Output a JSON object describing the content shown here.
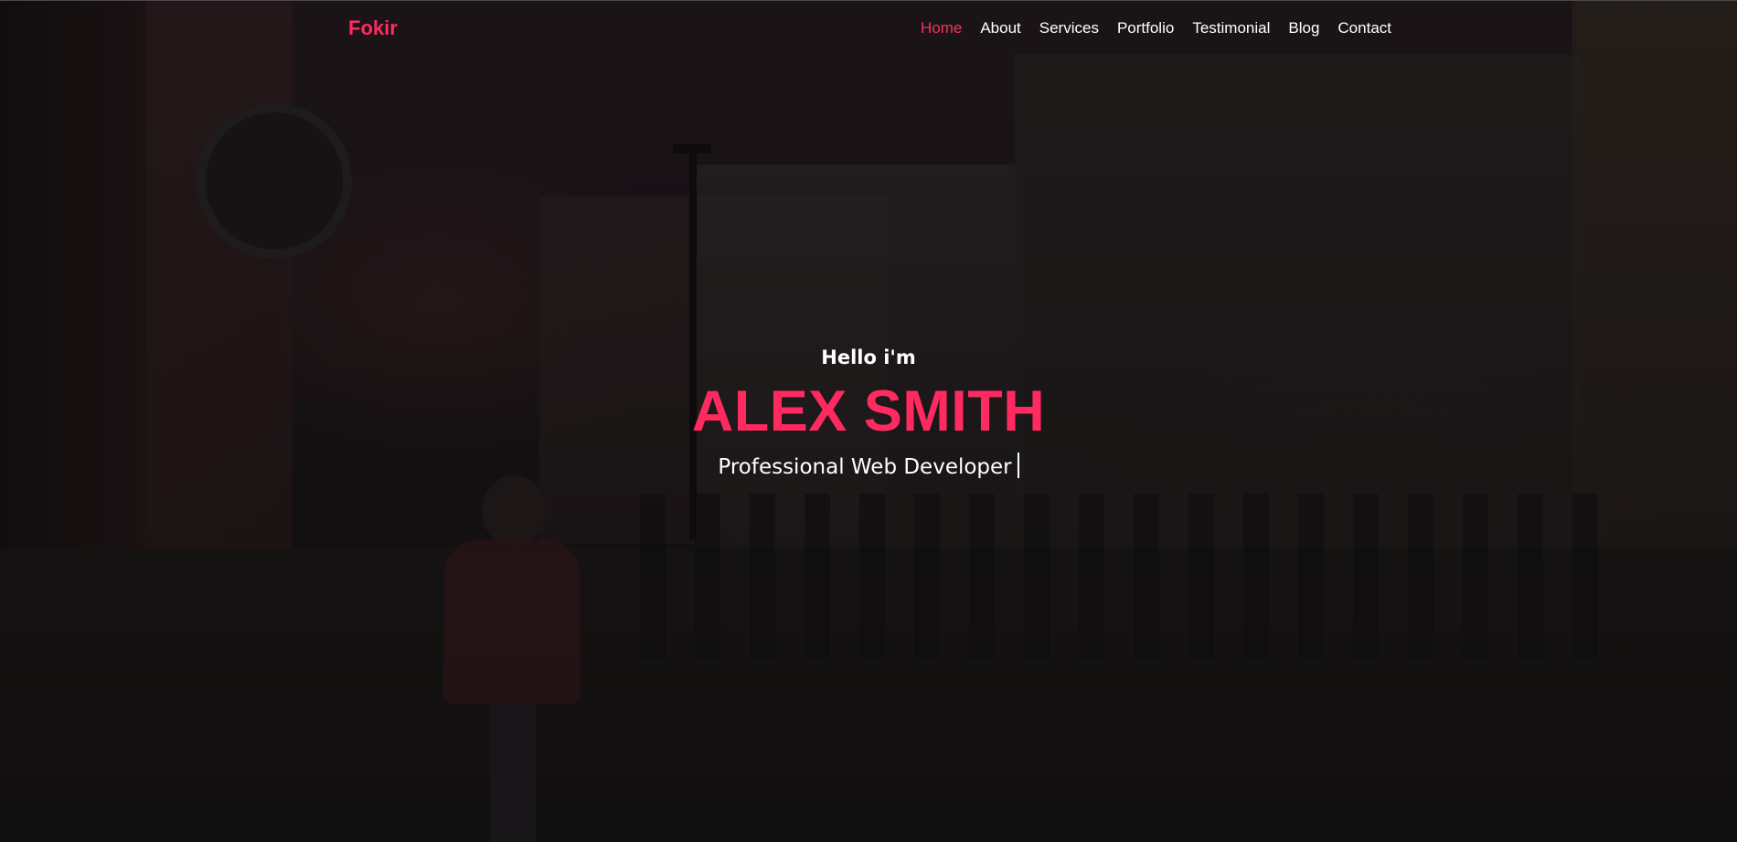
{
  "brand": {
    "name": "Fokir",
    "accent_color": "#ff2a5f"
  },
  "nav": {
    "items": [
      {
        "label": "Home",
        "active": true
      },
      {
        "label": "About",
        "active": false
      },
      {
        "label": "Services",
        "active": false
      },
      {
        "label": "Portfolio",
        "active": false
      },
      {
        "label": "Testimonial",
        "active": false
      },
      {
        "label": "Blog",
        "active": false
      },
      {
        "label": "Contact",
        "active": false
      }
    ]
  },
  "hero": {
    "greeting": "Hello i'm",
    "name": "ALEX SMITH",
    "subtitle": "Professional Web Developer",
    "background_icon": "city-street-photo"
  }
}
